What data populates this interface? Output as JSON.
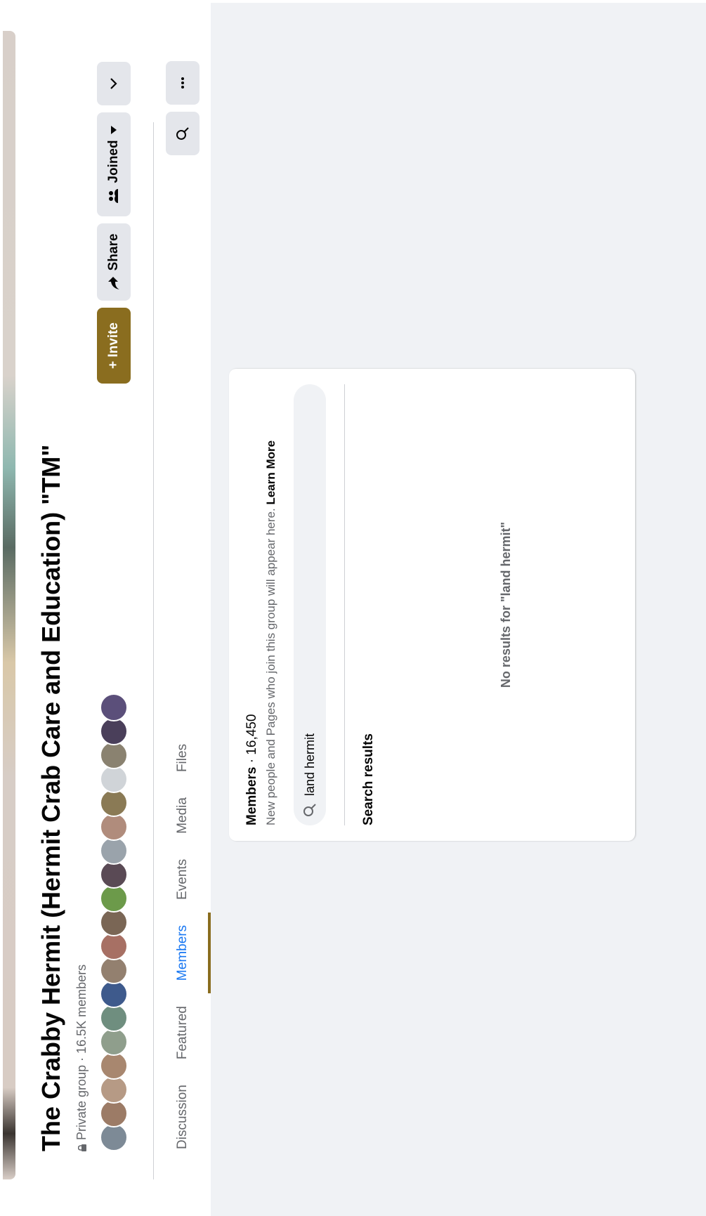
{
  "group": {
    "title": "The Crabby Hermit (Hermit Crab Care and Education) \"TM\"",
    "meta": "Private group · 16.5K members"
  },
  "actions": {
    "invite": "+ Invite",
    "share": "Share",
    "joined": "Joined"
  },
  "tabs": [
    "Discussion",
    "Featured",
    "Members",
    "Events",
    "Media",
    "Files"
  ],
  "active_tab": "Members",
  "members": {
    "title": "Members",
    "count": "· 16,450",
    "description": "New people and Pages who join this group will appear here.",
    "learn_more": "Learn More",
    "search_value": "land hermit",
    "results_label": "Search results",
    "no_results": "No results for \"land hermit\""
  },
  "colors": {
    "accent": "#8a6d1f",
    "active_tab": "#1877f2"
  }
}
